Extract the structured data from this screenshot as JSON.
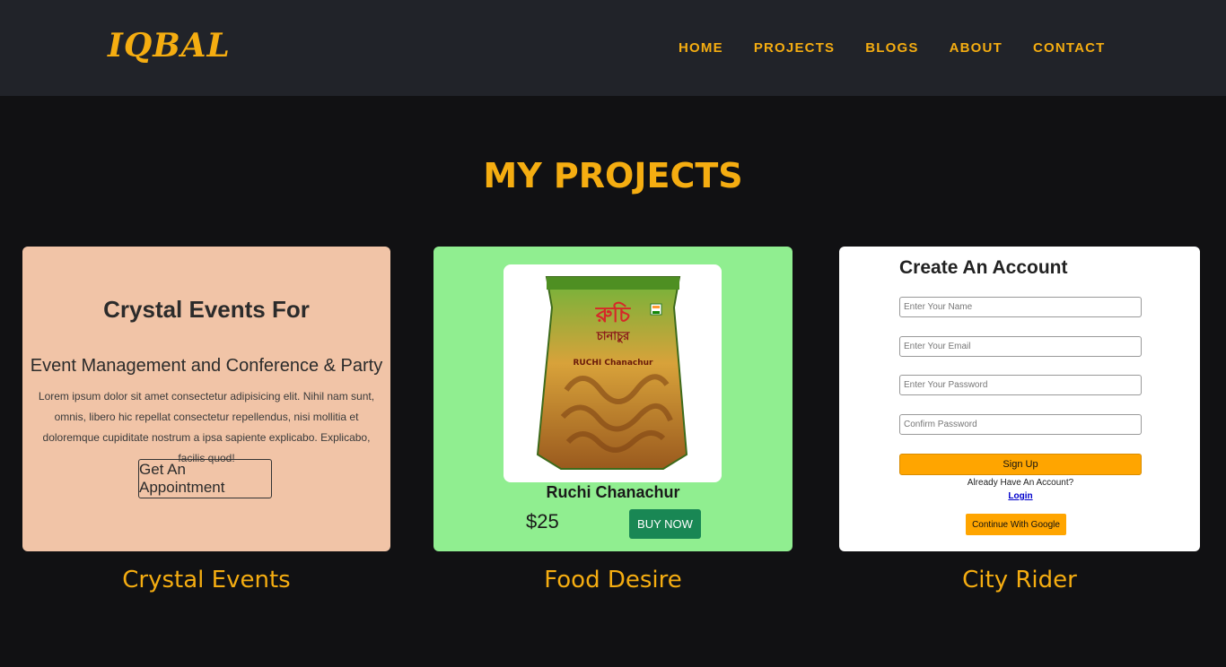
{
  "header": {
    "logo": "IQBAL",
    "nav": [
      "HOME",
      "PROJECTS",
      "BLOGS",
      "ABOUT",
      "CONTACT"
    ]
  },
  "main": {
    "title": "MY PROJECTS",
    "projects": [
      {
        "caption": "Crystal Events",
        "preview": {
          "title": "Crystal Events For",
          "subtitle": "Event Management and Conference & Party",
          "body": "Lorem ipsum dolor sit amet consectetur adipisicing elit. Nihil nam sunt, omnis, libero hic repellat consectetur repellendus, nisi mollitia et doloremque cupiditate nostrum a ipsa sapiente explicabo. Explicabo, facilis quod!",
          "button": "Get An Appointment"
        }
      },
      {
        "caption": "Food Desire",
        "preview": {
          "product": "Ruchi Chanachur",
          "price": "$25",
          "button": "BUY NOW",
          "package_bengali": "রুচি",
          "package_bengali_sub": "চানাচুর",
          "package_brand": "RUCHI Chanachur"
        }
      },
      {
        "caption": "City Rider",
        "preview": {
          "title": "Create An Account",
          "fields": [
            "Enter Your Name",
            "Enter Your Email",
            "Enter Your Password",
            "Confirm Password"
          ],
          "signup": "Sign Up",
          "already": "Already Have An Account?",
          "login": "Login",
          "google": "Continue With Google"
        }
      }
    ]
  },
  "colors": {
    "accent": "#f5ad11",
    "background": "#111113",
    "navbar": "#212329"
  }
}
